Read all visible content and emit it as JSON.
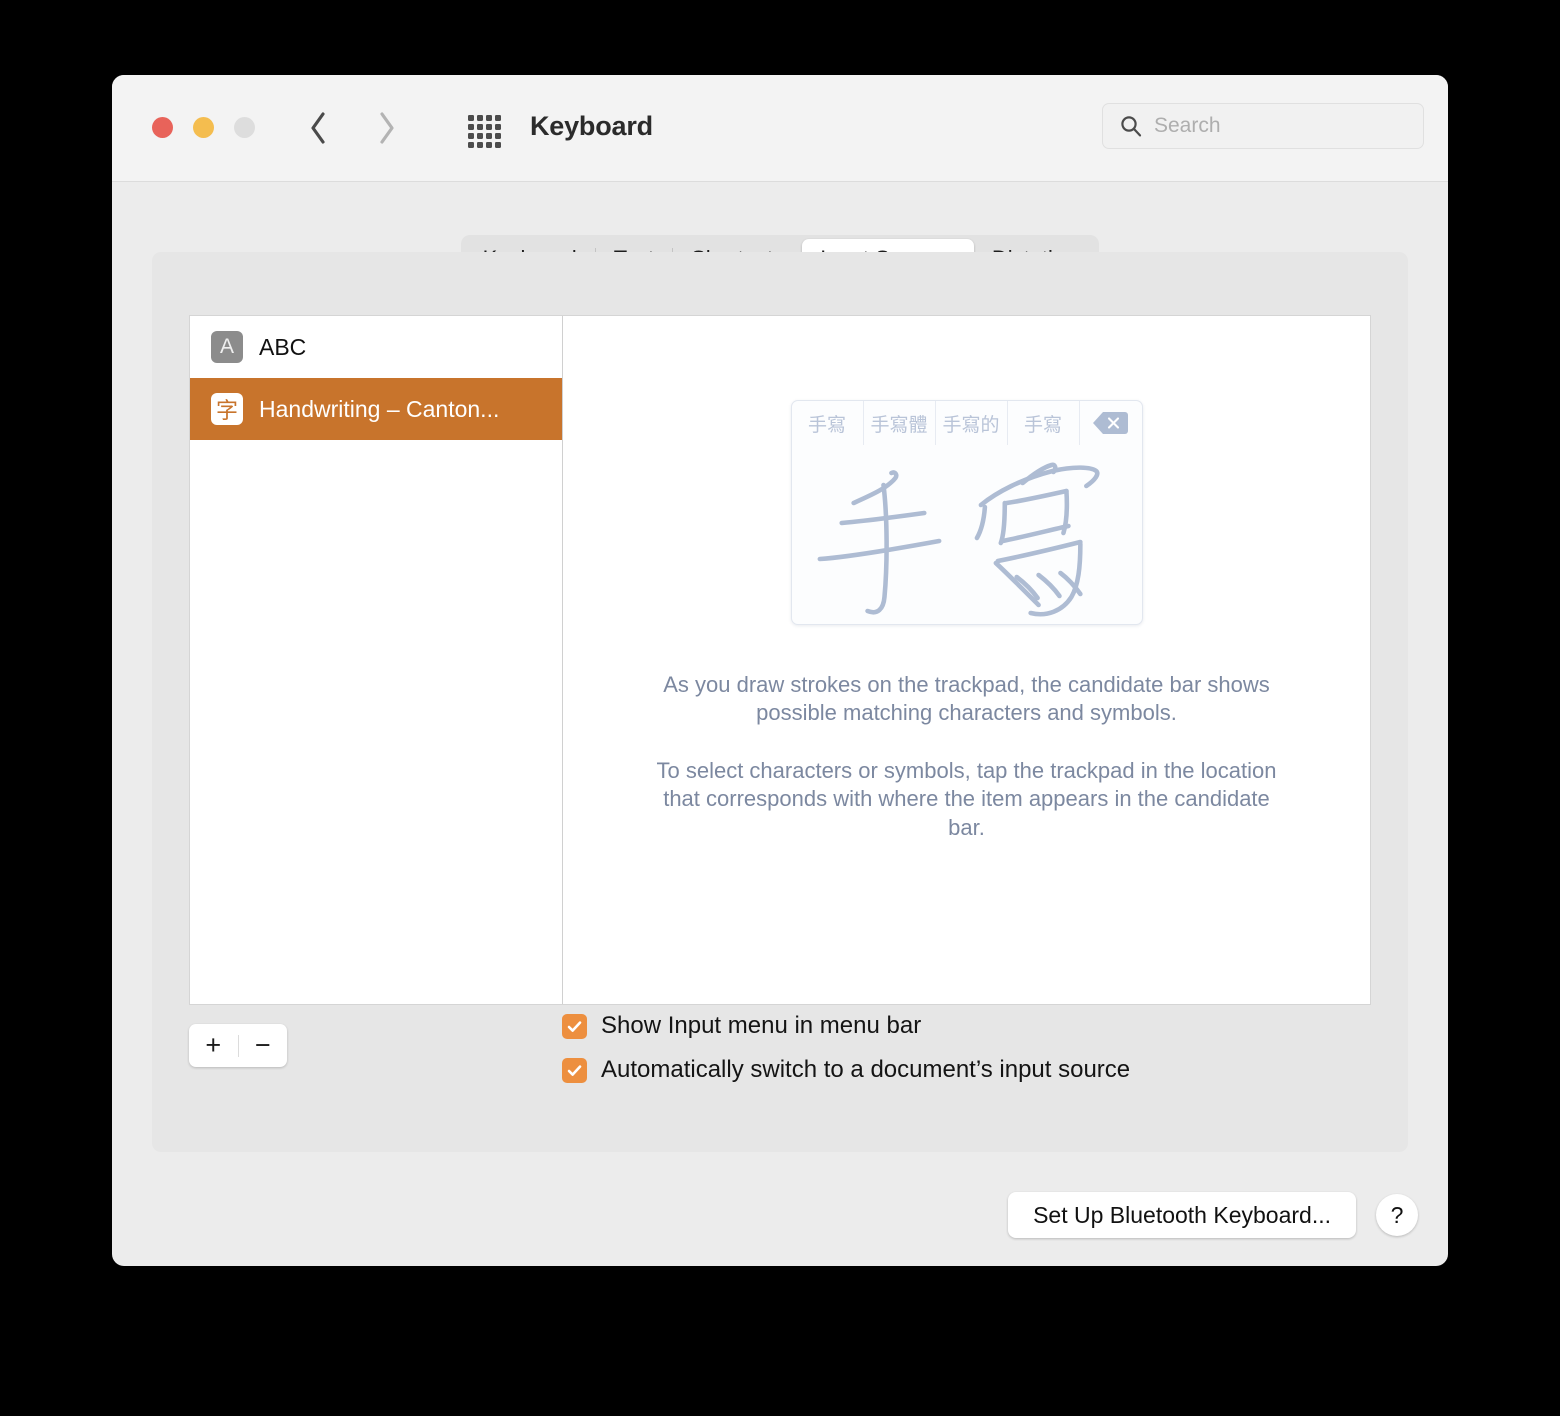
{
  "window": {
    "title": "Keyboard",
    "traffic_lights": [
      {
        "name": "close",
        "color": "#e8635a"
      },
      {
        "name": "minimize",
        "color": "#f4bd4f"
      },
      {
        "name": "zoom",
        "color": "#dddddd"
      }
    ],
    "nav": {
      "back_icon": "chevron-left-icon",
      "forward_icon": "chevron-right-icon"
    },
    "grid_icon": "show-all-preferences-icon"
  },
  "search": {
    "placeholder": "Search",
    "value": "",
    "icon": "search-icon"
  },
  "tabs": [
    {
      "label": "Keyboard",
      "selected": false
    },
    {
      "label": "Text",
      "selected": false
    },
    {
      "label": "Shortcuts",
      "selected": false
    },
    {
      "label": "Input Sources",
      "selected": true
    },
    {
      "label": "Dictation",
      "selected": false
    }
  ],
  "input_sources": [
    {
      "label": "ABC",
      "icon_glyph": "A",
      "icon_kind": "abc",
      "selected": false
    },
    {
      "label": "Handwriting – Canton...",
      "icon_glyph": "字",
      "icon_kind": "hw",
      "selected": true
    }
  ],
  "list_buttons": {
    "add_label": "+",
    "remove_label": "−"
  },
  "preview": {
    "candidates": [
      "手寫",
      "手寫體",
      "手寫的",
      "手寫"
    ],
    "delete_key_icon": "delete-key-icon",
    "canvas_text": "手寫",
    "description_1": "As you draw strokes on the trackpad, the candidate bar shows possible matching characters and symbols.",
    "description_2": "To select characters or symbols, tap the trackpad in the location that corresponds with where the item appears in the candidate bar."
  },
  "checkboxes": [
    {
      "label": "Show Input menu in menu bar",
      "checked": true
    },
    {
      "label": "Automatically switch to a document’s input source",
      "checked": true
    }
  ],
  "footer": {
    "bluetooth_button": "Set Up Bluetooth Keyboard...",
    "help_button": "?"
  },
  "colors": {
    "accent_orange": "#c8742c",
    "checkbox_orange": "#ed8f3f",
    "window_bg": "#ececec",
    "toolbar_bg": "#f3f3f3",
    "panel_bg": "#e6e6e6",
    "stroke_blue": "#aebcd3",
    "description_text": "#7c88a0"
  }
}
